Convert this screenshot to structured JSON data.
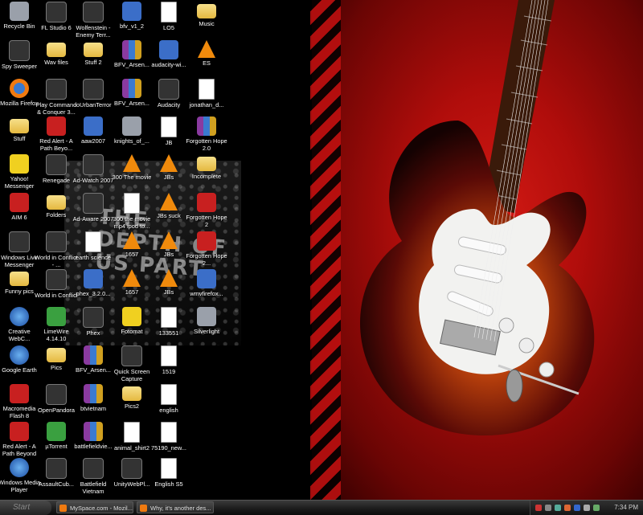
{
  "desktop": {
    "icons": [
      {
        "label": "Recycle Bin",
        "icon": "recycle-bin-icon"
      },
      {
        "label": "FL Studio 6",
        "icon": "fl-studio-icon"
      },
      {
        "label": "Wolfenstein - Enemy Terr...",
        "icon": "wolfenstein-icon"
      },
      {
        "label": "bfv_v1_2",
        "icon": "installer-icon"
      },
      {
        "label": "LO5",
        "icon": "document-icon"
      },
      {
        "label": "Music",
        "icon": "folder-icon"
      },
      {
        "label": "Spy Sweeper",
        "icon": "spy-sweeper-icon"
      },
      {
        "label": "Wav files",
        "icon": "folder-icon"
      },
      {
        "label": "Stuff 2",
        "icon": "folder-icon"
      },
      {
        "label": "BFV_Arsen...",
        "icon": "winrar-icon"
      },
      {
        "label": "audacity-wi...",
        "icon": "installer-icon"
      },
      {
        "label": "ES",
        "icon": "vlc-icon"
      },
      {
        "label": "Mozilla Firefox",
        "icon": "firefox-icon"
      },
      {
        "label": "Play Command & Conquer 3...",
        "icon": "command-conquer-icon"
      },
      {
        "label": "ioUrbanTerror",
        "icon": "urban-terror-icon"
      },
      {
        "label": "BFV_Arsen...",
        "icon": "winrar-icon"
      },
      {
        "label": "Audacity",
        "icon": "audacity-icon"
      },
      {
        "label": "jonathan_d...",
        "icon": "document-icon"
      },
      {
        "label": "Stuff",
        "icon": "folder-icon"
      },
      {
        "label": "Red Alert - A Path Beyo...",
        "icon": "red-alert-icon"
      },
      {
        "label": "aaw2007",
        "icon": "installer-icon"
      },
      {
        "label": "knights_of_...",
        "icon": "archive-icon"
      },
      {
        "label": "JB",
        "icon": "document-icon"
      },
      {
        "label": "Forgotten Hope 2.0",
        "icon": "winrar-icon"
      },
      {
        "label": "Yahoo! Messenger",
        "icon": "yahoo-messenger-icon"
      },
      {
        "label": "Renegade",
        "icon": "renegade-icon"
      },
      {
        "label": "Ad-Watch 2007",
        "icon": "ad-watch-icon"
      },
      {
        "label": "300 The movie",
        "icon": "vlc-icon"
      },
      {
        "label": "JBs",
        "icon": "vlc-icon"
      },
      {
        "label": "Incomplete",
        "icon": "folder-icon"
      },
      {
        "label": "AIM 6",
        "icon": "aim-icon"
      },
      {
        "label": "Folders",
        "icon": "folder-icon"
      },
      {
        "label": "Ad-Aware 2007",
        "icon": "ad-aware-icon"
      },
      {
        "label": "300 the movie mp4 ipod to...",
        "icon": "document-icon"
      },
      {
        "label": "JBs suck",
        "icon": "vlc-icon"
      },
      {
        "label": "Forgotten Hope 2",
        "icon": "forgotten-hope-icon"
      },
      {
        "label": "Windows Live Messenger",
        "icon": "messenger-icon"
      },
      {
        "label": "World in Conflict - ...",
        "icon": "world-in-conflict-icon"
      },
      {
        "label": "earth science",
        "icon": "word-document-icon"
      },
      {
        "label": "1657",
        "icon": "vlc-icon"
      },
      {
        "label": "JBs",
        "icon": "vlc-icon"
      },
      {
        "label": "Forgotten Hope 2...",
        "icon": "forgotten-hope-icon"
      },
      {
        "label": "Funny pics",
        "icon": "folder-icon"
      },
      {
        "label": "World in Conflict",
        "icon": "world-in-conflict-icon"
      },
      {
        "label": "phex_3.2.0...",
        "icon": "installer-icon"
      },
      {
        "label": "1657",
        "icon": "vlc-icon"
      },
      {
        "label": "JBs",
        "icon": "vlc-icon"
      },
      {
        "label": "wmvfirefox...",
        "icon": "installer-icon"
      },
      {
        "label": "Creative WebC...",
        "icon": "webcam-icon"
      },
      {
        "label": "LimeWire 4.14.10",
        "icon": "limewire-icon"
      },
      {
        "label": "Phex",
        "icon": "phex-icon"
      },
      {
        "label": "Fotomat",
        "icon": "fotomat-icon"
      },
      {
        "label": "133551",
        "icon": "document-icon"
      },
      {
        "label": "Silverlight",
        "icon": "silverlight-icon"
      },
      {
        "label": "Google Earth",
        "icon": "google-earth-icon"
      },
      {
        "label": "Pics",
        "icon": "folder-icon"
      },
      {
        "label": "BFV_Arsen...",
        "icon": "winrar-icon"
      },
      {
        "label": "Quick Screen Capture",
        "icon": "screen-capture-icon"
      },
      {
        "label": "1519",
        "icon": "document-icon"
      },
      {
        "label": "Macromedia Flash 8",
        "icon": "flash-icon"
      },
      {
        "label": "OpenPandora",
        "icon": "pandora-icon"
      },
      {
        "label": "btvietnam",
        "icon": "winrar-icon"
      },
      {
        "label": "Pics2",
        "icon": "folder-icon"
      },
      {
        "label": "english",
        "icon": "document-icon"
      },
      {
        "label": "Red Alert - A Path Beyond",
        "icon": "red-alert-icon"
      },
      {
        "label": "µTorrent",
        "icon": "utorrent-icon"
      },
      {
        "label": "battlefieldvie...",
        "icon": "winrar-icon"
      },
      {
        "label": "animal_shirt2",
        "icon": "document-icon"
      },
      {
        "label": "75190_new...",
        "icon": "document-icon"
      },
      {
        "label": "Windows Media Player",
        "icon": "media-player-icon"
      },
      {
        "label": "AssaultCub...",
        "icon": "assaultcube-icon"
      },
      {
        "label": "Battlefield Vietnam",
        "icon": "battlefield-icon"
      },
      {
        "label": "UnityWebPl...",
        "icon": "unity-icon"
      },
      {
        "label": "English S5",
        "icon": "word-document-icon"
      }
    ],
    "wallpaper_text": "THE DEPTH OF US PART"
  },
  "taskbar": {
    "start_label": "Start",
    "tasks": [
      {
        "label": "MySpace.com - Mozil..."
      },
      {
        "label": "Why, it's another des..."
      }
    ],
    "clock": "7:34 PM"
  },
  "colors": {
    "wallpaper_red": "#c0120e",
    "taskbar": "#1a1a1a",
    "icon_label": "#ffffff"
  }
}
